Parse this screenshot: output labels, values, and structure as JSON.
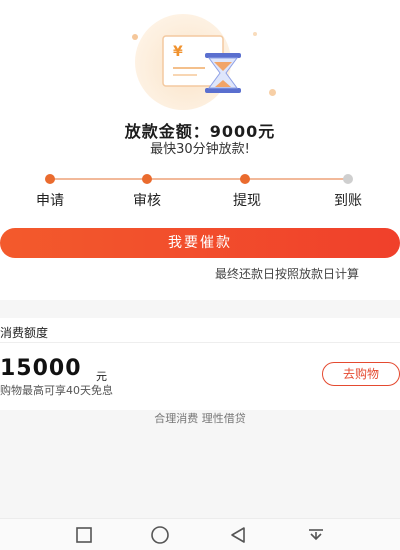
{
  "loan": {
    "amount_line": "放款金额：9000元",
    "speed_line": "最快30分钟放款!"
  },
  "steps": [
    {
      "label": "申请",
      "done": true
    },
    {
      "label": "审核",
      "done": true
    },
    {
      "label": "提现",
      "done": true
    },
    {
      "label": "到账",
      "done": false
    }
  ],
  "actions": {
    "urge_button": "我要催款",
    "repay_note": "最终还款日按照放款日计算"
  },
  "consumer_credit": {
    "title": "消费额度",
    "amount": "15000",
    "unit": "元",
    "description": "购物最高可享40天免息",
    "shop_button": "去购物"
  },
  "slogan": "合理消费 理性借贷",
  "icons": {
    "illustration": "hourglass-receipt-icon",
    "nav_recent": "square-icon",
    "nav_home": "circle-icon",
    "nav_back": "triangle-back-icon",
    "nav_notifications": "pull-down-icon"
  },
  "colors": {
    "accent": "#f0402b",
    "step_done": "#ea6b2e",
    "step_pending": "#cfcfcf"
  }
}
